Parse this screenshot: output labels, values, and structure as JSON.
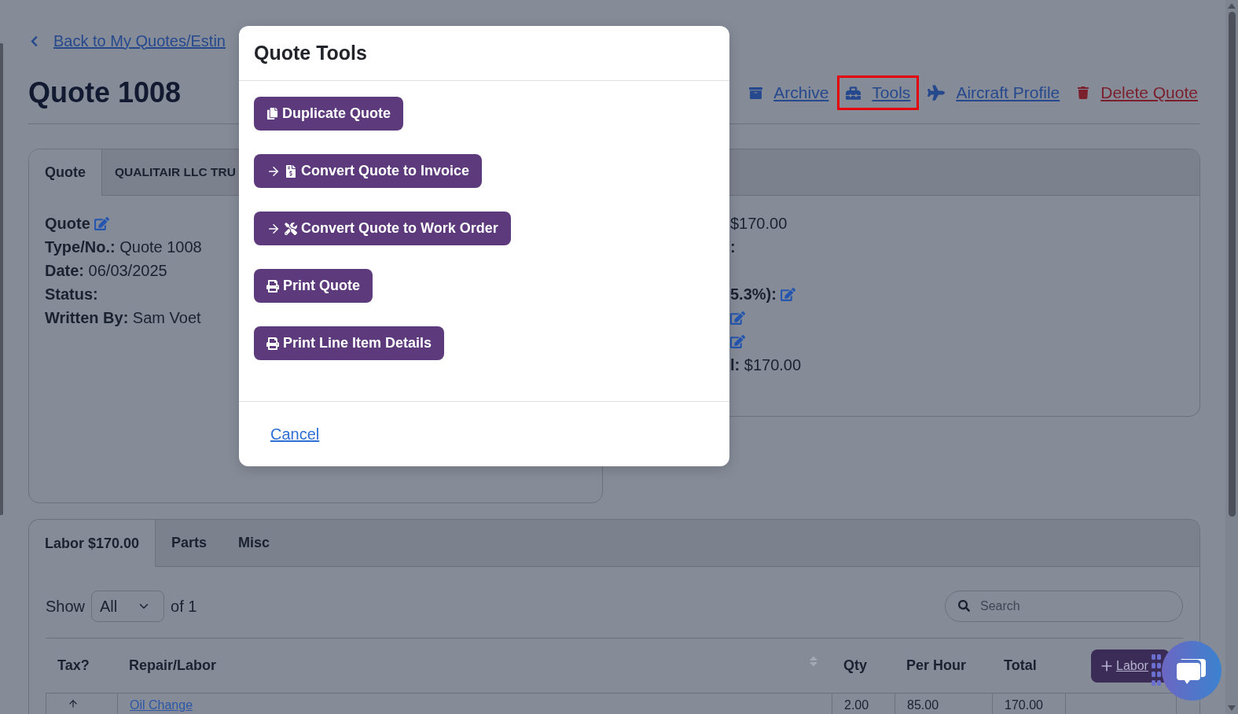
{
  "back_link": {
    "label": "Back to My Quotes/Estin"
  },
  "header": {
    "title": "Quote 1008",
    "actions": [
      {
        "kind": "archive",
        "label": "Archive",
        "highlighted": false
      },
      {
        "kind": "tools",
        "label": "Tools",
        "highlighted": true
      },
      {
        "kind": "aircraft",
        "label": "Aircraft Profile",
        "highlighted": false
      },
      {
        "kind": "delete",
        "label": "Delete Quote",
        "highlighted": false
      }
    ]
  },
  "info_card": {
    "tabs": [
      {
        "label": "Quote",
        "selected": true
      },
      {
        "label": "QUALITAIR LLC TRU",
        "selected": false
      }
    ],
    "heading": {
      "label": "Quote",
      "editable": true
    },
    "fields": [
      {
        "label": "Type/No.:",
        "value": "Quote 1008"
      },
      {
        "label": "Date:",
        "value": "06/03/2025"
      },
      {
        "label": "Status:"
      },
      {
        "label": "Written By:",
        "value": "Sam Voet"
      }
    ]
  },
  "totals_card": {
    "lines": [
      {
        "value": "$170.00",
        "editable": false
      },
      {
        "label": ":",
        "editable": false
      },
      {
        "label": "5.3%):",
        "editable": true
      },
      {
        "editable": true
      },
      {
        "editable": true
      },
      {
        "label": "l:",
        "value": "$170.00",
        "editable": false
      }
    ]
  },
  "items_card": {
    "tabs": [
      {
        "label": "Labor $170.00",
        "selected": true
      },
      {
        "label": "Parts",
        "selected": false
      },
      {
        "label": "Misc",
        "selected": false
      }
    ],
    "page_size": {
      "label": "Show",
      "value": "All",
      "suffix": "of 1"
    },
    "search": {
      "placeholder": "Search"
    },
    "columns": [
      {
        "label": "Tax?",
        "sortable": false
      },
      {
        "label": "Repair/Labor",
        "sortable": true
      },
      {
        "label": "Qty",
        "sortable": false
      },
      {
        "label": "Per Hour",
        "sortable": false
      },
      {
        "label": "Total",
        "sortable": false
      }
    ],
    "add_button": {
      "label": "Labor"
    },
    "rows": [
      {
        "name": "Oil Change",
        "qty": "2.00",
        "per_hour": "85.00",
        "total": "170.00"
      }
    ]
  },
  "modal": {
    "title": "Quote Tools",
    "actions": [
      {
        "kind": "duplicate",
        "label": "Duplicate Quote"
      },
      {
        "kind": "to_invoice",
        "label": "Convert Quote to Invoice"
      },
      {
        "kind": "to_work_order",
        "label": "Convert Quote to Work Order"
      },
      {
        "kind": "print",
        "label": "Print Quote"
      },
      {
        "kind": "print",
        "label": "Print Line Item Details"
      }
    ],
    "cancel": {
      "label": "Cancel"
    }
  }
}
